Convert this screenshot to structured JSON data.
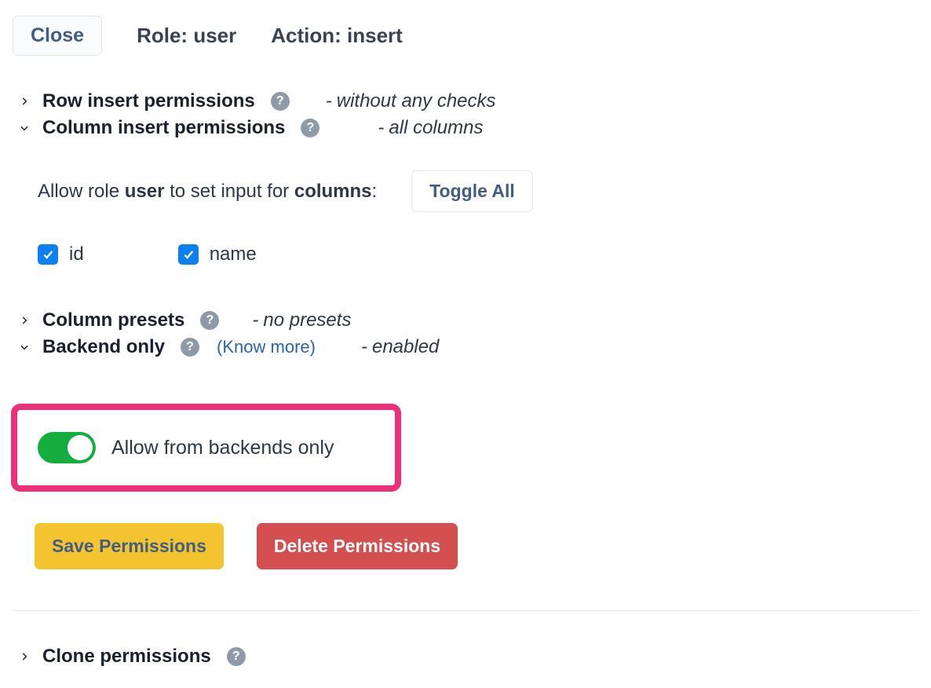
{
  "header": {
    "close_label": "Close",
    "role_prefix": "Role: ",
    "role_value": "user",
    "action_prefix": "Action: ",
    "action_value": "insert"
  },
  "sections": {
    "row_perm": {
      "label": "Row insert permissions",
      "status": "without any checks"
    },
    "col_perm": {
      "label": "Column insert permissions",
      "status": "all columns",
      "allow_prefix": "Allow role ",
      "allow_role": "user",
      "allow_mid": " to set input for ",
      "allow_target": "columns",
      "allow_suffix": ":",
      "toggle_all_label": "Toggle All",
      "columns": [
        {
          "name": "id",
          "checked": true
        },
        {
          "name": "name",
          "checked": true
        }
      ]
    },
    "col_presets": {
      "label": "Column presets",
      "status": "no presets"
    },
    "backend_only": {
      "label": "Backend only",
      "know_more": "(Know more)",
      "status": "enabled",
      "toggle_label": "Allow from backends only",
      "toggle_on": true
    },
    "clone": {
      "label": "Clone permissions"
    }
  },
  "buttons": {
    "save": "Save Permissions",
    "delete": "Delete Permissions"
  }
}
